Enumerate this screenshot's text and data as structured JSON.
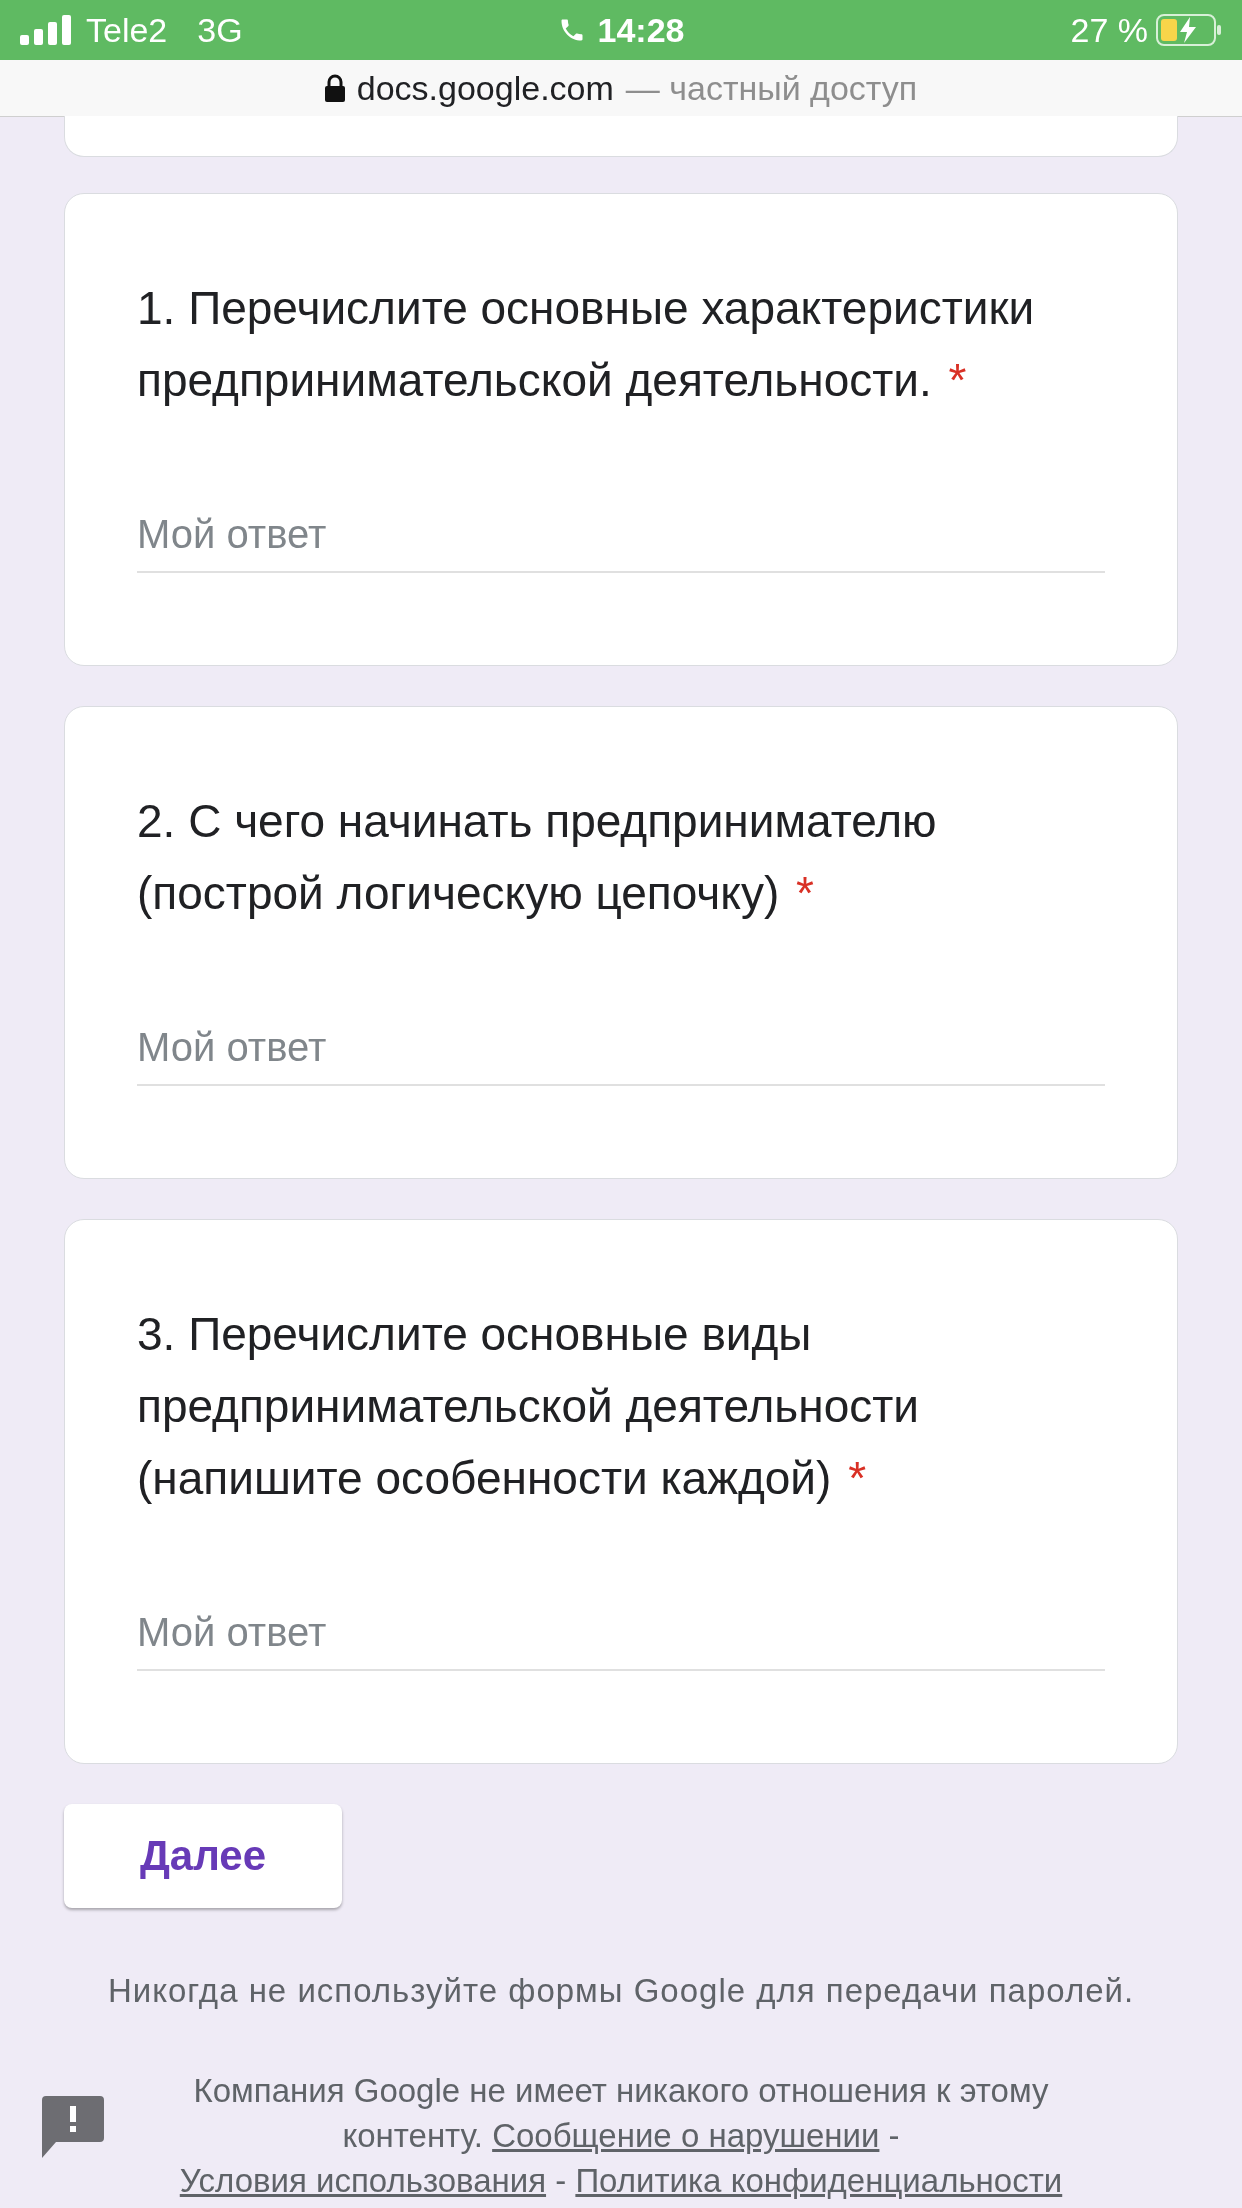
{
  "status_bar": {
    "carrier": "Tele2",
    "network": "3G",
    "time": "14:28",
    "battery": "27 %"
  },
  "address_bar": {
    "domain": "docs.google.com",
    "note": "— частный доступ"
  },
  "questions": [
    {
      "title": "1. Перечислите основные характеристики предпринимательской деятельности.",
      "required_mark": "*",
      "placeholder": "Мой ответ"
    },
    {
      "title": "2. С чего начинать предпринимателю (построй логическую цепочку)",
      "required_mark": "*",
      "placeholder": "Мой ответ"
    },
    {
      "title": "3. Перечислите основные виды предпринимательской деятельности (напишите особенности каждой)",
      "required_mark": "*",
      "placeholder": "Мой ответ"
    }
  ],
  "next_button": "Далее",
  "footer": {
    "warning": "Никогда не используйте формы Google для передачи паролей.",
    "disclaimer": "Компания Google не имеет никакого отношения к этому контенту.",
    "links": [
      "Сообщение о нарушении",
      "Условия использования",
      "Политика конфиденциальности"
    ],
    "separator": "-"
  }
}
